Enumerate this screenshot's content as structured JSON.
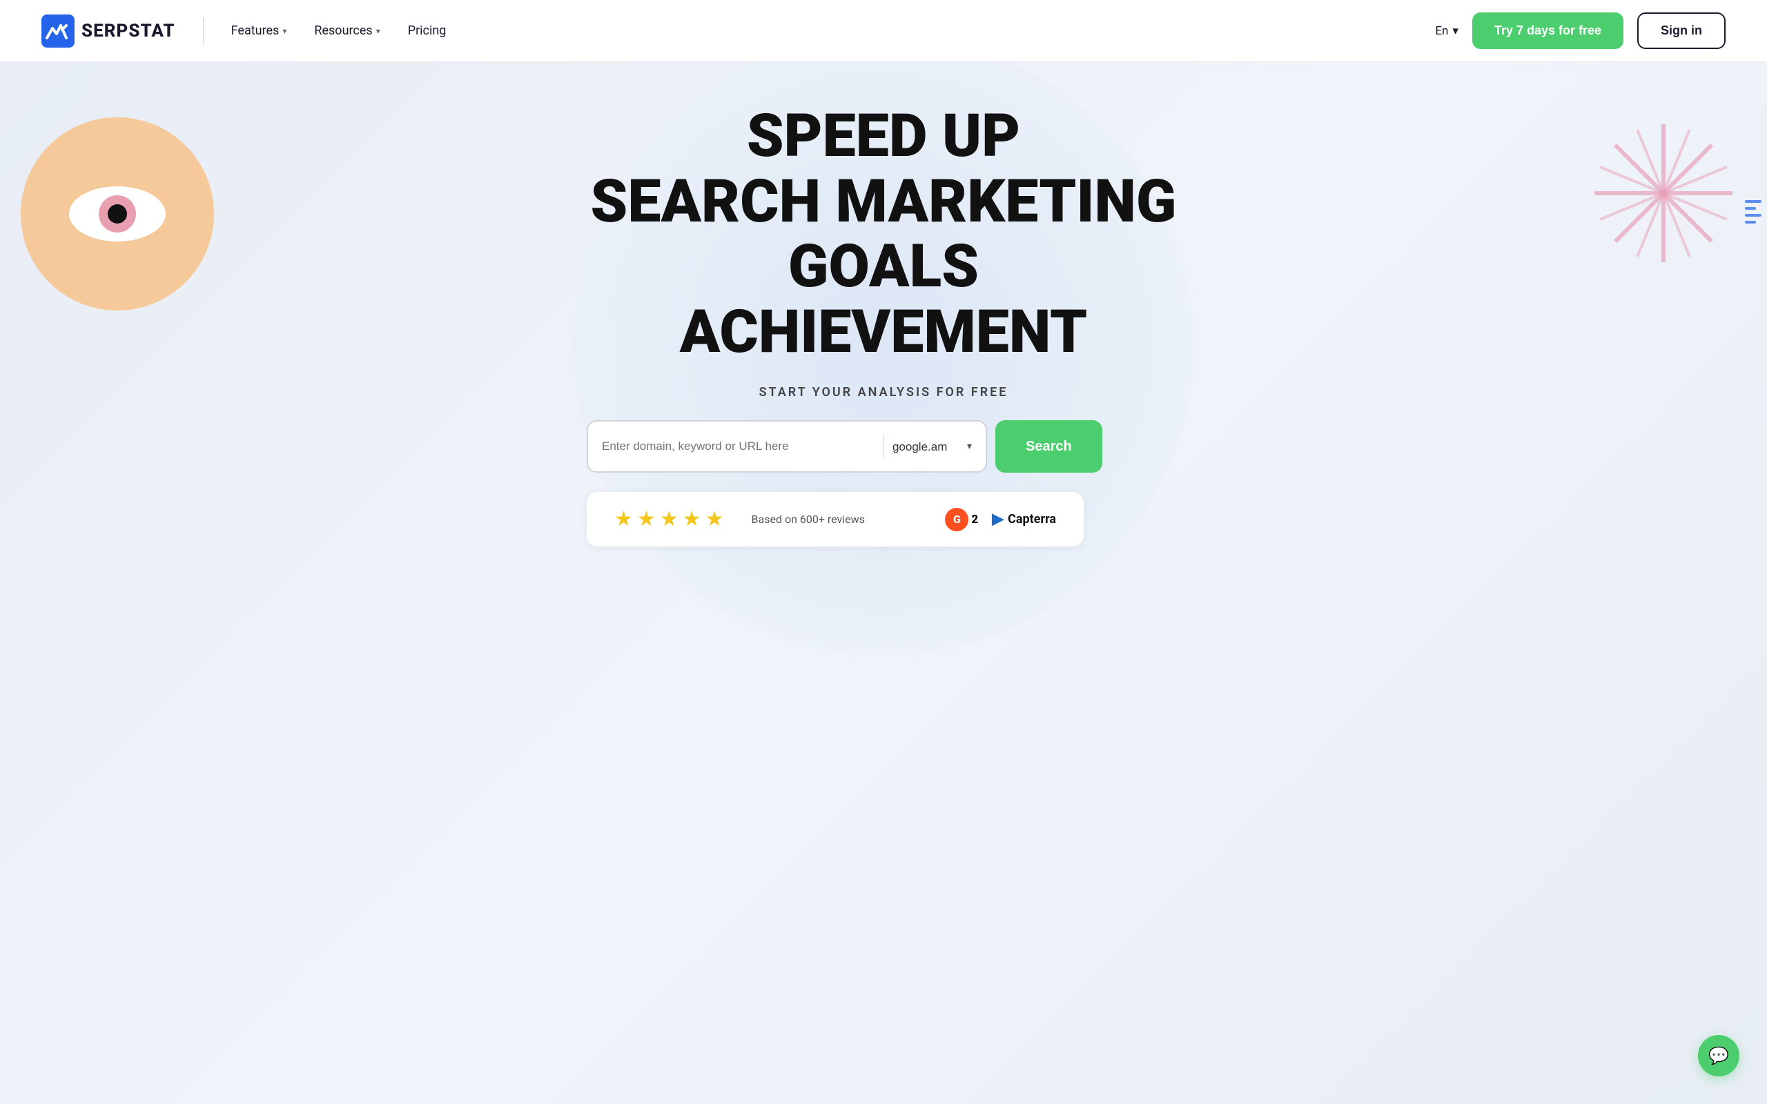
{
  "brand": {
    "name": "SERPSTAT",
    "logo_alt": "Serpstat logo"
  },
  "navbar": {
    "features_label": "Features",
    "resources_label": "Resources",
    "pricing_label": "Pricing",
    "lang_label": "En",
    "try_btn": "Try 7 days for free",
    "signin_btn": "Sign in"
  },
  "hero": {
    "title_line1": "SPEED UP",
    "title_line2": "SEARCH MARKETING",
    "title_line3": "GOALS ACHIEVEMENT",
    "subtitle": "START YOUR ANALYSIS FOR FREE",
    "search_placeholder": "Enter domain, keyword or URL here",
    "search_country": "google.am",
    "search_btn": "Search",
    "reviews_text": "Based on 600+ reviews",
    "g2_label": "G2",
    "capterra_label": "Capterra"
  },
  "chat": {
    "icon": "💬"
  }
}
